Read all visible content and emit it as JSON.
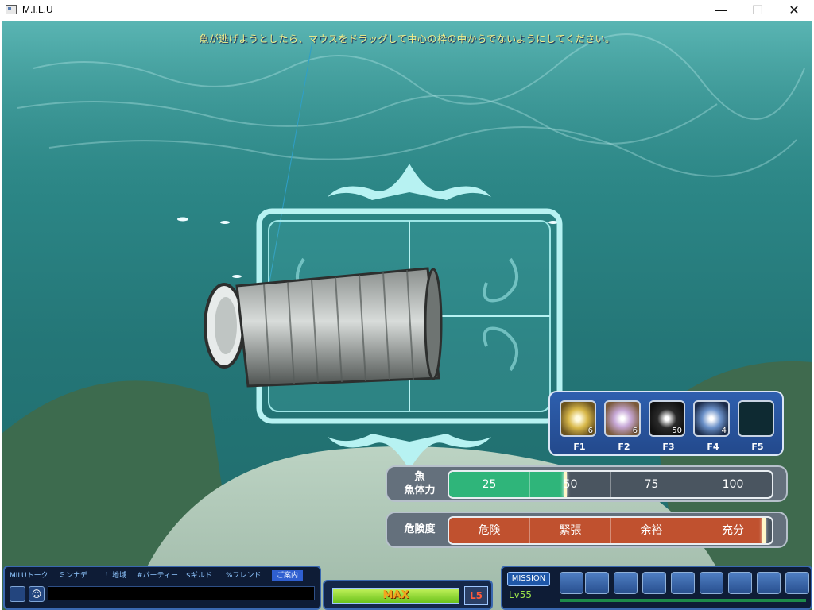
{
  "window": {
    "title": "M.I.L.U",
    "minimize": "—",
    "maximize": "☐",
    "close": "✕"
  },
  "instruction": "魚が逃げようとしたら、マウスをドラッグして中心の枠の中からでないようにしてください。",
  "skills": [
    {
      "key": "F1",
      "count": "6",
      "icon": "sparkle-icon"
    },
    {
      "key": "F2",
      "count": "6",
      "icon": "orb-icon"
    },
    {
      "key": "F3",
      "count": "50",
      "icon": "dark-orb-icon"
    },
    {
      "key": "F4",
      "count": "4",
      "icon": "lightning-orb-icon"
    },
    {
      "key": "F5",
      "count": "",
      "icon": ""
    }
  ],
  "stamina": {
    "label_line1": "魚",
    "label_line2": "魚体力",
    "ticks": [
      "25",
      "50",
      "75",
      "100"
    ],
    "value_percent": 36
  },
  "danger": {
    "label": "危険度",
    "levels": [
      "危険",
      "緊張",
      "余裕",
      "充分"
    ],
    "value_percent": 98
  },
  "chat": {
    "tabs": [
      "MILUトーク",
      "ミンナデ",
      "！地域",
      "#パーティー",
      "$ギルド",
      "%フレンド",
      "ご案内"
    ],
    "input_value": ""
  },
  "gauge": {
    "label": "MAX",
    "level": "L5",
    "fill_percent": 100
  },
  "status": {
    "mission": "MISSION",
    "level": "Lv55"
  },
  "colors": {
    "water": "#2a8282",
    "stamina_fill": "#2fb57a",
    "danger_fill": "#c0512f",
    "hud_blue": "#3a68b0",
    "instruction": "#f5f08a"
  }
}
